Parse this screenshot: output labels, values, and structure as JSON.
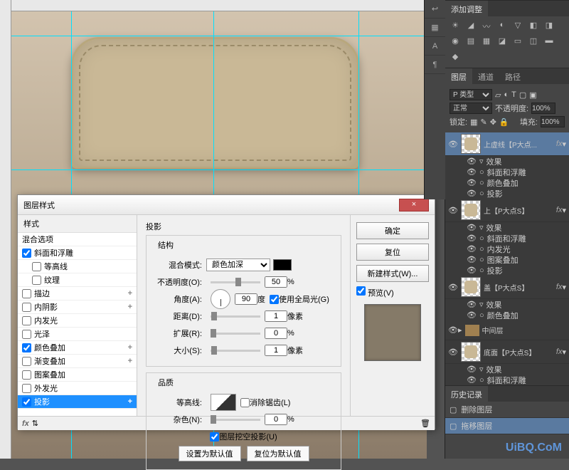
{
  "dialog": {
    "title": "图层样式",
    "close_x": "×",
    "styles_header": "样式",
    "blend_options": "混合选项",
    "items": [
      {
        "label": "斜面和浮雕",
        "checked": true,
        "plus": false
      },
      {
        "label": "等高线",
        "checked": false,
        "sub": true
      },
      {
        "label": "纹理",
        "checked": false,
        "sub": true
      },
      {
        "label": "描边",
        "checked": false,
        "plus": true
      },
      {
        "label": "内阴影",
        "checked": false,
        "plus": true
      },
      {
        "label": "内发光",
        "checked": false
      },
      {
        "label": "光泽",
        "checked": false
      },
      {
        "label": "颜色叠加",
        "checked": true,
        "plus": true
      },
      {
        "label": "渐变叠加",
        "checked": false,
        "plus": true
      },
      {
        "label": "图案叠加",
        "checked": false
      },
      {
        "label": "外发光",
        "checked": false
      },
      {
        "label": "投影",
        "checked": true,
        "plus": true,
        "selected": true
      }
    ],
    "section": "投影",
    "structure_title": "结构",
    "blend_mode_label": "混合模式:",
    "blend_mode_value": "颜色加深",
    "opacity_label": "不透明度(O):",
    "opacity_value": "50",
    "opacity_pct": "%",
    "angle_label": "角度(A):",
    "angle_value": "90",
    "angle_unit": "度",
    "global_light": "使用全局光(G)",
    "distance_label": "距离(D):",
    "distance_value": "1",
    "px_unit": "像素",
    "spread_label": "扩展(R):",
    "spread_value": "0",
    "pct_unit": "%",
    "size_label": "大小(S):",
    "size_value": "1",
    "quality_title": "品质",
    "contour_label": "等高线:",
    "antialias": "消除锯齿(L)",
    "noise_label": "杂色(N):",
    "noise_value": "0",
    "knockout": "图层挖空投影(U)",
    "make_default": "设置为默认值",
    "reset_default": "复位为默认值",
    "btn_ok": "确定",
    "btn_cancel": "复位",
    "btn_new_style": "新建样式(W)...",
    "preview_label": "预览(V)",
    "fx_icon": "fx"
  },
  "adjustments_panel": {
    "title": "添加调整"
  },
  "layers_panel": {
    "tabs": [
      "图层",
      "通道",
      "路径"
    ],
    "kind": "P 类型",
    "blend_mode": "正常",
    "opacity_label": "不透明度:",
    "opacity": "100%",
    "lock_label": "锁定:",
    "fill_label": "填充:",
    "fill": "100%",
    "layers": [
      {
        "name": "上虚线【P大点...",
        "fx": true,
        "selected": true,
        "effects_title": "效果",
        "effects": [
          "斜面和浮雕",
          "颜色叠加",
          "投影"
        ]
      },
      {
        "name": "上【P大点S】",
        "fx": true,
        "effects_title": "效果",
        "effects": [
          "斜面和浮雕",
          "内发光",
          "图案叠加",
          "投影"
        ]
      },
      {
        "name": "盖【P大点S】",
        "fx": true,
        "effects_title": "效果",
        "effects": [
          "颜色叠加"
        ]
      },
      {
        "name": "中间层",
        "folder": true
      },
      {
        "name": "底面【P大点S】",
        "fx": true,
        "effects_title": "效果",
        "effects": [
          "斜面和浮雕"
        ]
      }
    ]
  },
  "history_panel": {
    "title": "历史记录",
    "items": [
      "删除图层",
      "拖移图层"
    ]
  },
  "watermark": "UiBQ.CoM"
}
